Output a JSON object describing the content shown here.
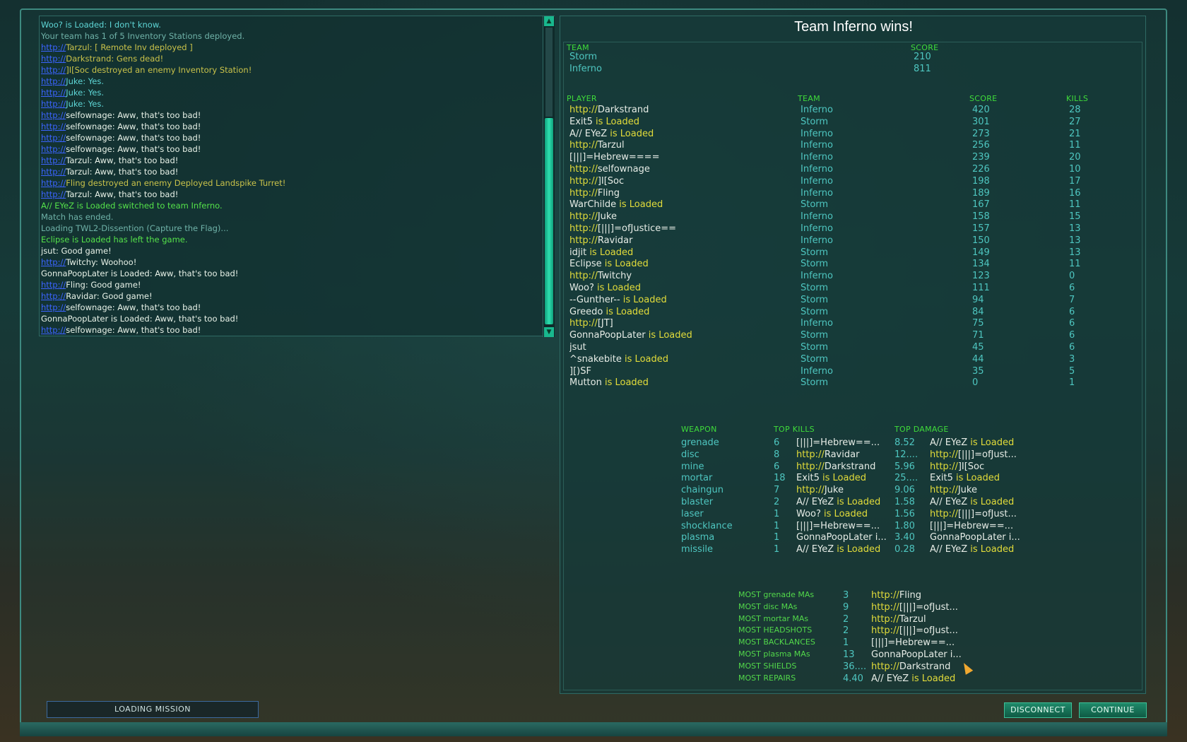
{
  "chat": {
    "lines": [
      {
        "prefix": "",
        "text": "Woo? is Loaded: I don't know.",
        "color": "cyan"
      },
      {
        "prefix": "",
        "text": "Your team has 1 of 5 Inventory Stations deployed.",
        "color": "gray"
      },
      {
        "prefix": "http://",
        "text": "Tarzul: [ Remote Inv deployed ]",
        "color": "yellow"
      },
      {
        "prefix": "http://",
        "text": "Darkstrand: Gens dead!",
        "color": "yellow"
      },
      {
        "prefix": "http://",
        "text": "]I[Soc destroyed an enemy  Inventory Station!",
        "color": "yellow"
      },
      {
        "prefix": "http://",
        "text": "Juke: Yes.",
        "color": "cyan"
      },
      {
        "prefix": "http://",
        "text": "Juke: Yes.",
        "color": "cyan"
      },
      {
        "prefix": "http://",
        "text": "Juke: Yes.",
        "color": "cyan"
      },
      {
        "prefix": "http://",
        "text": "selfownage: Aww, that's too bad!",
        "color": "white"
      },
      {
        "prefix": "http://",
        "text": "selfownage: Aww, that's too bad!",
        "color": "white"
      },
      {
        "prefix": "http://",
        "text": "selfownage: Aww, that's too bad!",
        "color": "white"
      },
      {
        "prefix": "http://",
        "text": "selfownage: Aww, that's too bad!",
        "color": "white"
      },
      {
        "prefix": "http://",
        "text": "Tarzul: Aww, that's too bad!",
        "color": "white"
      },
      {
        "prefix": "http://",
        "text": "Tarzul: Aww, that's too bad!",
        "color": "white"
      },
      {
        "prefix": "http://",
        "text": "Fling destroyed an enemy Deployed Landspike Turret!",
        "color": "yellow"
      },
      {
        "prefix": "http://",
        "text": "Tarzul: Aww, that's too bad!",
        "color": "white"
      },
      {
        "prefix": "",
        "text": "A// EYeZ is Loaded switched to team Inferno.",
        "color": "green"
      },
      {
        "prefix": "",
        "text": "Match has ended.",
        "color": "gray"
      },
      {
        "prefix": "",
        "text": "Loading TWL2-Dissention (Capture the Flag)...",
        "color": "gray"
      },
      {
        "prefix": "",
        "text": "Eclipse is Loaded has left the game.",
        "color": "green"
      },
      {
        "prefix": "",
        "text": "jsut: Good game!",
        "color": "white"
      },
      {
        "prefix": "http://",
        "text": "Twitchy: Woohoo!",
        "color": "white"
      },
      {
        "prefix": "",
        "text": "GonnaPoopLater is Loaded: Aww, that's too bad!",
        "color": "white"
      },
      {
        "prefix": "http://",
        "text": "Fling: Good game!",
        "color": "white"
      },
      {
        "prefix": "http://",
        "text": "Ravidar: Good game!",
        "color": "white"
      },
      {
        "prefix": "http://",
        "text": "selfownage: Aww, that's too bad!",
        "color": "white"
      },
      {
        "prefix": "",
        "text": "GonnaPoopLater is Loaded: Aww, that's too bad!",
        "color": "white"
      },
      {
        "prefix": "http://",
        "text": "selfownage: Aww, that's too bad!",
        "color": "white"
      }
    ]
  },
  "loading_label": "LOADING MISSION",
  "scoreboard": {
    "winner": "Team Inferno wins!",
    "team_headers": {
      "team": "TEAM",
      "score": "SCORE"
    },
    "teams": [
      {
        "name": "Storm",
        "score": "210"
      },
      {
        "name": "Inferno",
        "score": "811"
      }
    ],
    "player_headers": {
      "player": "PLAYER",
      "team": "TEAM",
      "score": "SCORE",
      "kills": "KILLS"
    },
    "players": [
      {
        "pre": "http://",
        "name": "Darkstrand",
        "suf": "",
        "team": "Inferno",
        "score": "420",
        "kills": "28"
      },
      {
        "pre": "",
        "name": "Exit5",
        "suf": " is Loaded",
        "team": "Storm",
        "score": "301",
        "kills": "27"
      },
      {
        "pre": "",
        "name": "A// EYeZ",
        "suf": " is Loaded",
        "team": "Inferno",
        "score": "273",
        "kills": "21"
      },
      {
        "pre": "http://",
        "name": "Tarzul",
        "suf": "",
        "team": "Inferno",
        "score": "256",
        "kills": "11"
      },
      {
        "pre": "",
        "name": "[|||]=Hebrew====",
        "suf": "",
        "team": "Inferno",
        "score": "239",
        "kills": "20"
      },
      {
        "pre": "http://",
        "name": "selfownage",
        "suf": "",
        "team": "Inferno",
        "score": "226",
        "kills": "10"
      },
      {
        "pre": "http://",
        "name": "]I[Soc",
        "suf": "",
        "team": "Inferno",
        "score": "198",
        "kills": "17"
      },
      {
        "pre": "http://",
        "name": "Fling",
        "suf": "",
        "team": "Inferno",
        "score": "189",
        "kills": "16"
      },
      {
        "pre": "",
        "name": "WarChilde",
        "suf": " is Loaded",
        "team": "Storm",
        "score": "167",
        "kills": "11"
      },
      {
        "pre": "http://",
        "name": "Juke",
        "suf": "",
        "team": "Inferno",
        "score": "158",
        "kills": "15"
      },
      {
        "pre": "http://",
        "name": "[|||]=ofJustice==",
        "suf": "",
        "team": "Inferno",
        "score": "157",
        "kills": "13"
      },
      {
        "pre": "http://",
        "name": "Ravidar",
        "suf": "",
        "team": "Inferno",
        "score": "150",
        "kills": "13"
      },
      {
        "pre": "",
        "name": "idjit",
        "suf": " is Loaded",
        "team": "Storm",
        "score": "149",
        "kills": "13"
      },
      {
        "pre": "",
        "name": "Eclipse",
        "suf": " is Loaded",
        "team": "Storm",
        "score": "134",
        "kills": "11"
      },
      {
        "pre": "http://",
        "name": "Twitchy",
        "suf": "",
        "team": "Inferno",
        "score": "123",
        "kills": "0"
      },
      {
        "pre": "",
        "name": "Woo?",
        "suf": " is Loaded",
        "team": "Storm",
        "score": "111",
        "kills": "6"
      },
      {
        "pre": "",
        "name": "--Gunther--",
        "suf": " is Loaded",
        "team": "Storm",
        "score": "94",
        "kills": "7"
      },
      {
        "pre": "",
        "name": "Greedo",
        "suf": " is Loaded",
        "team": "Storm",
        "score": "84",
        "kills": "6"
      },
      {
        "pre": "http://",
        "name": "[JT]",
        "suf": "",
        "team": "Inferno",
        "score": "75",
        "kills": "6"
      },
      {
        "pre": "",
        "name": "GonnaPoopLater",
        "suf": " is Loaded",
        "team": "Storm",
        "score": "71",
        "kills": "6"
      },
      {
        "pre": "",
        "name": "jsut",
        "suf": "",
        "team": "Storm",
        "score": "45",
        "kills": "6"
      },
      {
        "pre": "",
        "name": "^snakebite",
        "suf": " is Loaded",
        "team": "Storm",
        "score": "44",
        "kills": "3"
      },
      {
        "pre": "",
        "name": "][)SF",
        "suf": "",
        "team": "Inferno",
        "score": "35",
        "kills": "5"
      },
      {
        "pre": "",
        "name": "Mutton",
        "suf": " is Loaded",
        "team": "Storm",
        "score": "0",
        "kills": "1"
      }
    ],
    "weapon_headers": {
      "weapon": "WEAPON",
      "top_kills": "TOP KILLS",
      "top_damage": "TOP DAMAGE"
    },
    "weapons": [
      {
        "weapon": "grenade",
        "kills": "6",
        "k_pre": "",
        "k_name": "[|||]=Hebrew==...",
        "k_suf": "",
        "dmg": "8.52",
        "d_pre": "",
        "d_name": "A// EYeZ",
        "d_suf": " is Loaded"
      },
      {
        "weapon": "disc",
        "kills": "8",
        "k_pre": "http://",
        "k_name": "Ravidar",
        "k_suf": "",
        "dmg": "12....",
        "d_pre": "http://",
        "d_name": "[|||]=ofJust...",
        "d_suf": ""
      },
      {
        "weapon": "mine",
        "kills": "6",
        "k_pre": "http://",
        "k_name": "Darkstrand",
        "k_suf": "",
        "dmg": "5.96",
        "d_pre": "http://",
        "d_name": "]I[Soc",
        "d_suf": ""
      },
      {
        "weapon": "mortar",
        "kills": "18",
        "k_pre": "",
        "k_name": "Exit5",
        "k_suf": " is Loaded",
        "dmg": "25....",
        "d_pre": "",
        "d_name": "Exit5",
        "d_suf": " is Loaded"
      },
      {
        "weapon": "chaingun",
        "kills": "7",
        "k_pre": "http://",
        "k_name": "Juke",
        "k_suf": "",
        "dmg": "9.06",
        "d_pre": "http://",
        "d_name": "Juke",
        "d_suf": ""
      },
      {
        "weapon": "blaster",
        "kills": "2",
        "k_pre": "",
        "k_name": "A// EYeZ",
        "k_suf": " is Loaded",
        "dmg": "1.58",
        "d_pre": "",
        "d_name": "A// EYeZ",
        "d_suf": " is Loaded"
      },
      {
        "weapon": "laser",
        "kills": "1",
        "k_pre": "",
        "k_name": "Woo?",
        "k_suf": " is Loaded",
        "dmg": "1.56",
        "d_pre": "http://",
        "d_name": "[|||]=ofJust...",
        "d_suf": ""
      },
      {
        "weapon": "shocklance",
        "kills": "1",
        "k_pre": "",
        "k_name": "[|||]=Hebrew==...",
        "k_suf": "",
        "dmg": "1.80",
        "d_pre": "",
        "d_name": "[|||]=Hebrew==...",
        "d_suf": ""
      },
      {
        "weapon": "plasma",
        "kills": "1",
        "k_pre": "",
        "k_name": "GonnaPoopLater i...",
        "k_suf": "",
        "dmg": "3.40",
        "d_pre": "",
        "d_name": "GonnaPoopLater i...",
        "d_suf": ""
      },
      {
        "weapon": "missile",
        "kills": "1",
        "k_pre": "",
        "k_name": "A// EYeZ",
        "k_suf": " is Loaded",
        "dmg": "0.28",
        "d_pre": "",
        "d_name": "A// EYeZ",
        "d_suf": " is Loaded"
      }
    ],
    "awards": [
      {
        "label": "MOST grenade MAs",
        "value": "3",
        "pre": "http://",
        "name": "Fling",
        "suf": ""
      },
      {
        "label": "MOST disc MAs",
        "value": "9",
        "pre": "http://",
        "name": "[|||]=ofJust...",
        "suf": ""
      },
      {
        "label": "MOST mortar MAs",
        "value": "2",
        "pre": "http://",
        "name": "Tarzul",
        "suf": ""
      },
      {
        "label": "MOST HEADSHOTS",
        "value": "2",
        "pre": "http://",
        "name": "[|||]=ofJust...",
        "suf": ""
      },
      {
        "label": "MOST BACKLANCES",
        "value": "1",
        "pre": "",
        "name": "[|||]=Hebrew==...",
        "suf": ""
      },
      {
        "label": "MOST plasma MAs",
        "value": "13",
        "pre": "",
        "name": "GonnaPoopLater i...",
        "suf": ""
      },
      {
        "label": "MOST SHIELDS",
        "value": "36....",
        "pre": "http://",
        "name": "Darkstrand",
        "suf": ""
      },
      {
        "label": "MOST REPAIRS",
        "value": "4.40",
        "pre": "",
        "name": "A// EYeZ",
        "suf": " is Loaded"
      }
    ]
  },
  "buttons": {
    "disconnect": "DISCONNECT",
    "continue": "CONTINUE"
  },
  "colors": {
    "accent_green": "#3fdc3a",
    "name_yellow": "#e2dc3a",
    "team_teal": "#4ec6c0",
    "button_green": "#1f8a6a"
  }
}
